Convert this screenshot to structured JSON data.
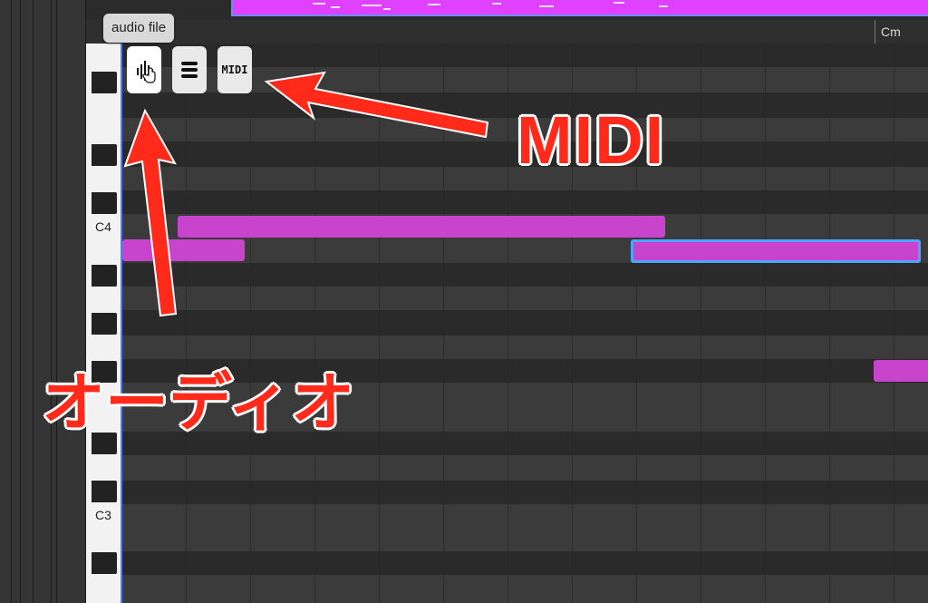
{
  "tooltip": {
    "text": "audio file"
  },
  "ruler": {
    "chord": "Cm"
  },
  "keyboard": {
    "labels": {
      "c4": "C4",
      "c3": "C3"
    }
  },
  "file_icons": [
    {
      "name": "audio-file",
      "icon": "audio-file-icon",
      "active": true
    },
    {
      "name": "text-file",
      "icon": "text-file-icon",
      "active": false
    },
    {
      "name": "midi-file",
      "icon": "midi-file-icon",
      "label": "MIDI",
      "active": false
    }
  ],
  "annotations": {
    "midi": "MIDI",
    "audio": "オーディオ"
  },
  "colors": {
    "note": "#c844cc",
    "region": "#e040ff",
    "selection": "#4ea3ff",
    "annotation": "#ff2a1a",
    "playhead": "#4a7cff"
  }
}
